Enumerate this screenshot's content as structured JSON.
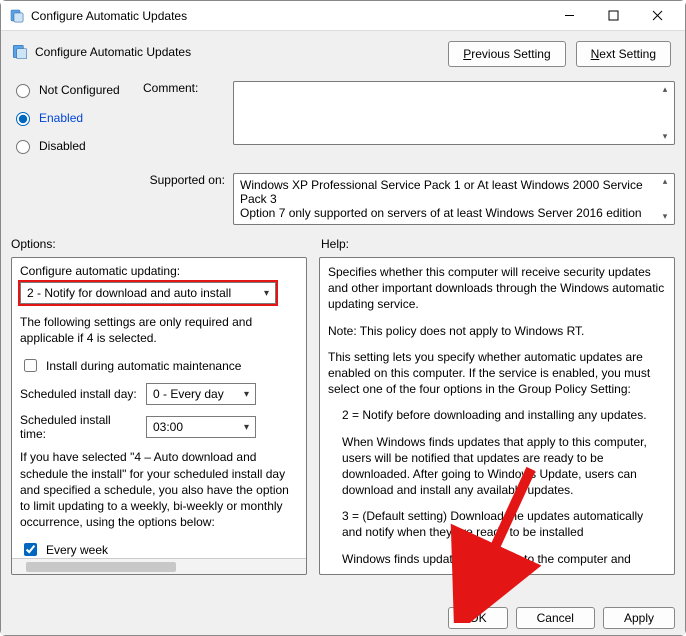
{
  "window": {
    "title": "Configure Automatic Updates"
  },
  "header": {
    "policy_name": "Configure Automatic Updates",
    "prev_u": "P",
    "prev_rest": "revious Setting",
    "next_u": "N",
    "next_rest": "ext Setting"
  },
  "state": {
    "not_configured": "Not Configured",
    "enabled": "Enabled",
    "disabled": "Disabled",
    "selected": "enabled"
  },
  "comment_label": "Comment:",
  "supported_label": "Supported on:",
  "supported_text": "Windows XP Professional Service Pack 1 or At least Windows 2000 Service Pack 3\nOption 7 only supported on servers of at least Windows Server 2016 edition",
  "panes": {
    "options_label": "Options:",
    "help_label": "Help:"
  },
  "options": {
    "heading": "Configure automatic updating:",
    "mode_value": "2 - Notify for download and auto install",
    "note": "The following settings are only required and applicable if 4 is selected.",
    "maintenance_label": "Install during automatic maintenance",
    "day_label": "Scheduled install day:",
    "day_value": "0 - Every day",
    "time_label": "Scheduled install time:",
    "time_value": "03:00",
    "para2": "If you have selected \"4 – Auto download and schedule the install\" for your scheduled install day and specified a schedule, you also have the option to limit updating to a weekly, bi-weekly or monthly occurrence, using the options below:",
    "every_week": "Every week"
  },
  "help_paras": [
    "Specifies whether this computer will receive security updates and other important downloads through the Windows automatic updating service.",
    "Note: This policy does not apply to Windows RT.",
    "This setting lets you specify whether automatic updates are enabled on this computer. If the service is enabled, you must select one of the four options in the Group Policy Setting:",
    "2 = Notify before downloading and installing any updates.",
    "When Windows finds updates that apply to this computer, users will be notified that updates are ready to be downloaded. After going to Windows Update, users can download and install any available updates.",
    "3 = (Default setting) Download the updates automatically and notify when they are ready to be installed",
    "Windows finds updates that apply to the computer and"
  ],
  "footer": {
    "ok": "OK",
    "cancel": "Cancel",
    "apply": "Apply"
  }
}
